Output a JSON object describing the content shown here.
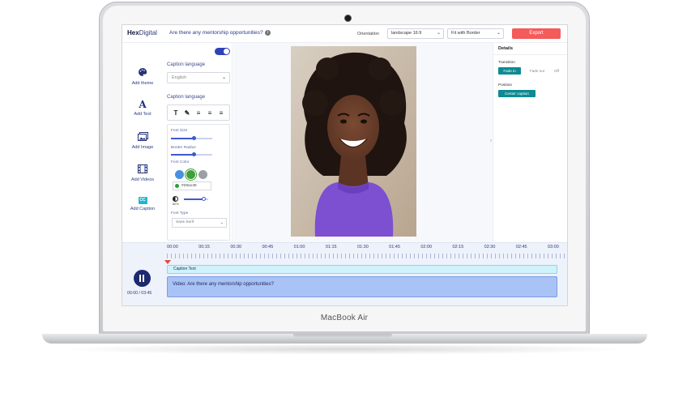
{
  "device": {
    "label": "MacBook Air"
  },
  "topbar": {
    "logo_bold": "Hex",
    "logo_rest": "Digital",
    "project_title": "Are there any mentorship opportunities?",
    "orientation_label": "Orientation",
    "orientation_value": "landscape 16:9",
    "fit_value": "Fit with Border",
    "export_label": "Export"
  },
  "rail": {
    "items": [
      {
        "label": "Add theme",
        "icon": "palette-icon"
      },
      {
        "label": "Add Text",
        "icon": "text-icon"
      },
      {
        "label": "Add Image",
        "icon": "image-icon"
      },
      {
        "label": "Add Videos",
        "icon": "film-icon"
      },
      {
        "label": "Add Caption",
        "icon": "cc-icon"
      }
    ],
    "cc_text": "CC"
  },
  "caption_panel": {
    "toggle_on": true,
    "language_label": "Caption language",
    "language_value": "English",
    "style_label": "Caption language",
    "tools": [
      "T",
      "✎",
      "≡",
      "≡",
      "≡"
    ],
    "font_size_label": "Font Size",
    "font_size_level": 0.55,
    "border_radius_label": "Border Radius",
    "border_radius_level": 0.55,
    "font_color_label": "Font Color",
    "swatch_colors": [
      "#4a90e2",
      "#3fa03a",
      "#9aa0a6"
    ],
    "hex_value": "#29a135",
    "opacity_value": "80%",
    "opacity_level": 0.8,
    "font_type_label": "Font Type",
    "font_type_value": "Sans Serif"
  },
  "details": {
    "title": "Details",
    "transition_label": "Transition",
    "transition_options": [
      "Fade in",
      "Fade out",
      "Off"
    ],
    "transition_selected": "Fade in",
    "position_label": "Position",
    "position_value": "Center caption"
  },
  "timeline": {
    "time_readout": "00:00 / 03:45",
    "ticks": [
      "00:00",
      "00:15",
      "00:30",
      "00:45",
      "01:00",
      "01:15",
      "01:30",
      "01:45",
      "02:00",
      "02:15",
      "02:30",
      "02:45",
      "03:00"
    ],
    "caption_track_label": "Caption Text",
    "video_track_label": "Video: Are there any mentorship opportunities?"
  },
  "colors": {
    "accent": "#2f42b8",
    "export": "#f45b5b",
    "chip": "#0d8a92",
    "dress": "#7d4fd1"
  }
}
